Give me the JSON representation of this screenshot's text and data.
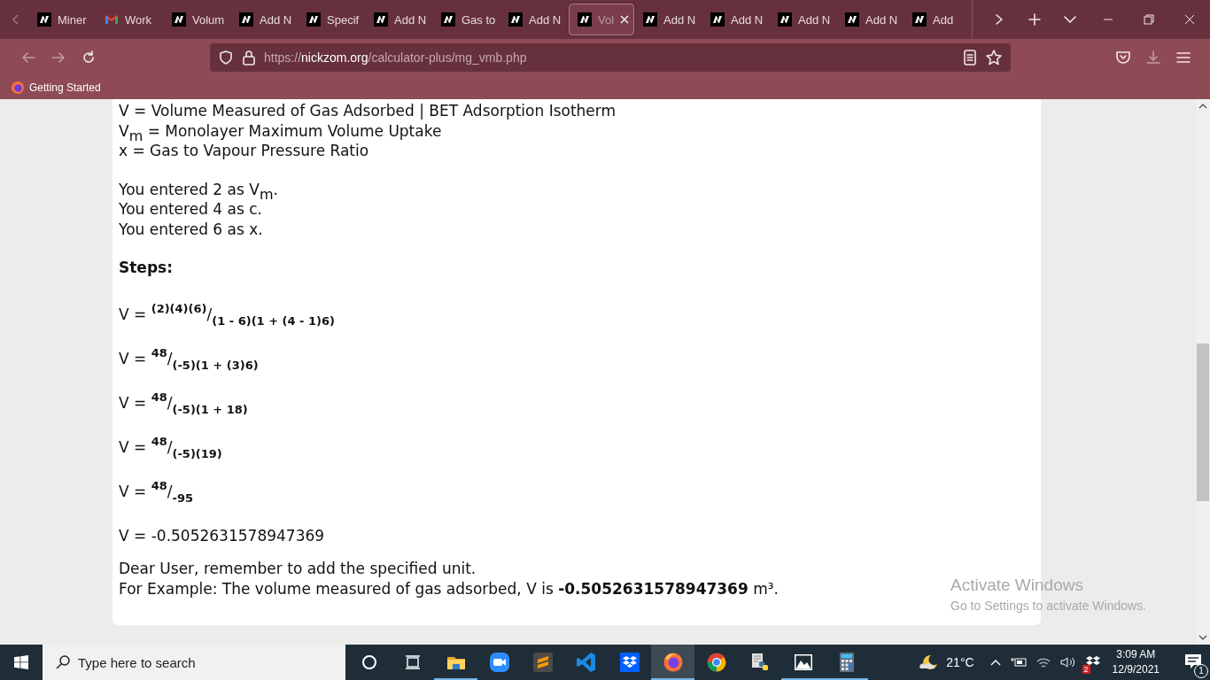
{
  "browser": {
    "tabs": [
      {
        "label": "Miner",
        "kind": "site",
        "selected": false
      },
      {
        "label": "Work",
        "kind": "mail",
        "selected": false
      },
      {
        "label": "Volum",
        "kind": "site",
        "selected": false
      },
      {
        "label": "Add N",
        "kind": "site",
        "selected": false
      },
      {
        "label": "Specif",
        "kind": "site",
        "selected": false
      },
      {
        "label": "Add N",
        "kind": "site",
        "selected": false
      },
      {
        "label": "Gas to",
        "kind": "site",
        "selected": false
      },
      {
        "label": "Add N",
        "kind": "site",
        "selected": false
      },
      {
        "label": "Vol",
        "kind": "site",
        "selected": true
      },
      {
        "label": "Add N",
        "kind": "site",
        "selected": false
      },
      {
        "label": "Add N",
        "kind": "site",
        "selected": false
      },
      {
        "label": "Add N",
        "kind": "site",
        "selected": false
      },
      {
        "label": "Add N",
        "kind": "site",
        "selected": false
      },
      {
        "label": "Add",
        "kind": "site",
        "selected": false
      }
    ],
    "address": {
      "scheme": "https://",
      "host": "nickzom.org",
      "path": "/calculator-plus/mg_vmb.php"
    },
    "bookmarks": [
      "Getting Started"
    ]
  },
  "page": {
    "legend": [
      "V = Volume Measured of Gas Adsorbed | BET Adsorption Isotherm",
      "V$_{m}$ = Monolayer Maximum Volume Uptake",
      "x = Gas to Vapour Pressure Ratio"
    ],
    "entered": [
      "You entered 2 as V$_{m}$.",
      "You entered 4 as c.",
      "You entered 6 as x."
    ],
    "steps_heading": "Steps:",
    "steps": [
      "V = $^{(2)(4)(6)}$/$_{(1 - 6)(1 + (4 - 1)6)}$",
      "V = $^{48}$/$_{(-5)(1 + (3)6)}$",
      "V = $^{48}$/$_{(-5)(1 + 18)}$",
      "V = $^{48}$/$_{(-5)(19)}$",
      "V = $^{48}$/$_{-95}$",
      "V = -0.5052631578947369"
    ],
    "note": [
      "Dear User, remember to add the specified unit.",
      "For Example: The volume measured of gas adsorbed, V is **-0.5052631578947369** m³."
    ]
  },
  "activation": {
    "title": "Activate Windows",
    "text": "Go to Settings to activate Windows."
  },
  "taskbar": {
    "search": {
      "placeholder": "Type here to search"
    },
    "apps": [
      {
        "kind": "explorer",
        "running": true,
        "active": false
      },
      {
        "kind": "zoom",
        "running": false,
        "active": false
      },
      {
        "kind": "sublime",
        "running": false,
        "active": false
      },
      {
        "kind": "vscode",
        "running": false,
        "active": false
      },
      {
        "kind": "dropbox",
        "running": false,
        "active": false
      },
      {
        "kind": "firefox",
        "running": true,
        "active": true
      },
      {
        "kind": "chrome",
        "running": false,
        "active": false
      },
      {
        "kind": "python",
        "running": false,
        "active": false
      },
      {
        "kind": "photos",
        "running": true,
        "active": false
      },
      {
        "kind": "calculator",
        "running": true,
        "active": false
      }
    ],
    "temperature": "21°C",
    "dropbox_badge": "2",
    "time": "3:09 AM",
    "date": "12/9/2021",
    "notifications": "1"
  }
}
